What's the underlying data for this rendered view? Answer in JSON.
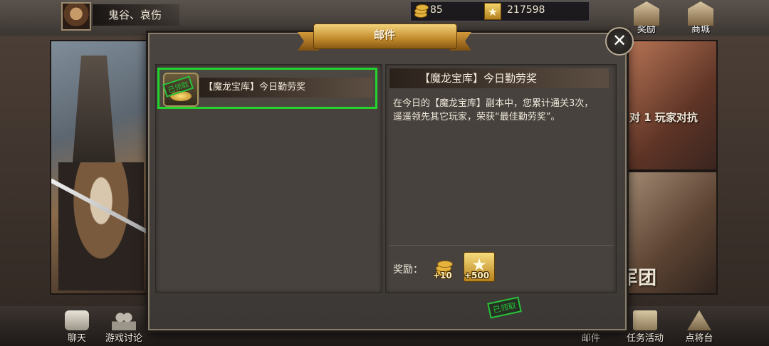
{
  "hud": {
    "player_name": "鬼谷、哀伤",
    "coins": "85",
    "gold": "217598",
    "reward_label": "奖励",
    "shop_label": "商城"
  },
  "background": {
    "right_top_label": "对 1 玩家对抗",
    "right_bottom_label": "军团"
  },
  "dialog": {
    "title": "邮件",
    "close_glyph": "✕",
    "mail_list": [
      {
        "subject": "【魔龙宝库】今日勤劳奖",
        "status": "已领取",
        "selected": true
      }
    ],
    "detail": {
      "title": "【魔龙宝库】今日勤劳奖",
      "body": "在今日的【魔龙宝库】副本中，您累计通关3次，遥遥领先其它玩家，荣获“最佳勤劳奖”。",
      "rewards_label": "奖励：",
      "rewards": [
        {
          "icon": "coin-icon",
          "amount": "+10"
        },
        {
          "icon": "star-icon",
          "amount": "+500"
        }
      ],
      "claimed_stamp": "已领取"
    }
  },
  "bottom_bar": {
    "chat": "聊天",
    "discussion": "游戏讨论",
    "mail": "邮件",
    "quests": "任务活动",
    "generals": "点将台"
  },
  "colors": {
    "selection_border": "#22d42c",
    "banner_gold": "#c18b2c",
    "stamp_green": "#27c23a"
  }
}
